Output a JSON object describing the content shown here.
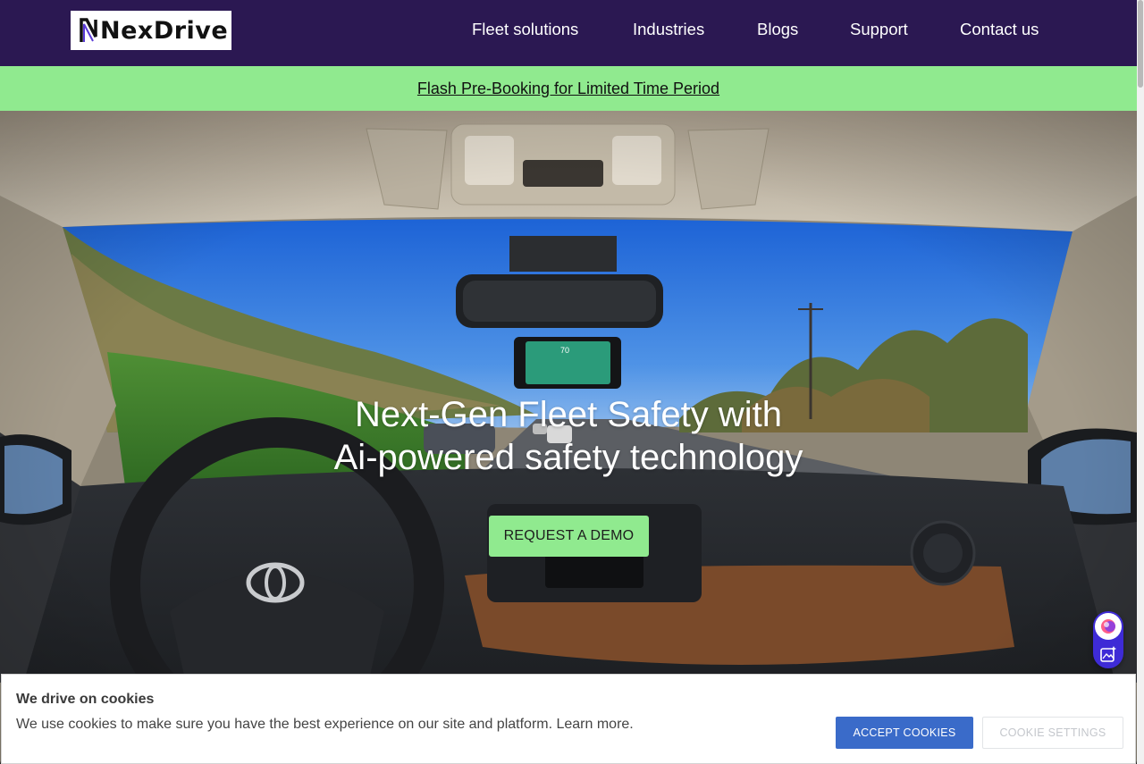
{
  "brand": {
    "name": "NexDrive",
    "colors": {
      "header": "#2b1852",
      "accent": "#90ea8f",
      "primary": "#3a6bc9"
    }
  },
  "nav": {
    "items": [
      {
        "label": "Fleet solutions"
      },
      {
        "label": "Industries"
      },
      {
        "label": "Blogs"
      },
      {
        "label": "Support"
      },
      {
        "label": "Contact us"
      }
    ]
  },
  "promo": {
    "text": "Flash Pre-Booking for Limited Time Period"
  },
  "hero": {
    "title_line1": "Next-Gen Fleet Safety with",
    "title_line2": "Ai-powered safety technology",
    "cta": "REQUEST A DEMO",
    "dashcam_speed": "70"
  },
  "cookie": {
    "title": "We drive on cookies",
    "text": "We use cookies to make sure you have the best experience on our site and platform. Learn more.",
    "accept": "ACCEPT COOKIES",
    "settings": "COOKIE SETTINGS"
  },
  "icons": {
    "widget_top": "chat-orb-icon",
    "widget_bottom": "image-sparkle-icon"
  }
}
